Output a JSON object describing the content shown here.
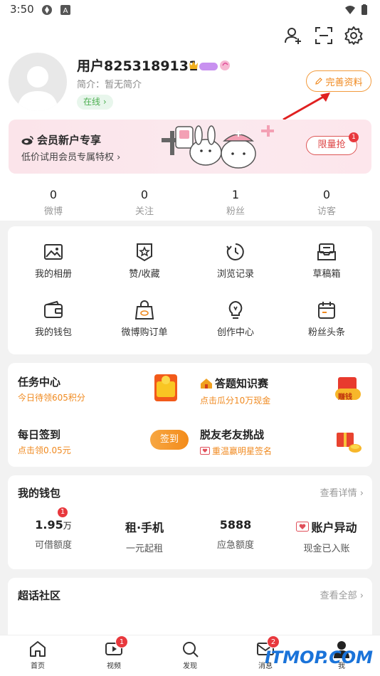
{
  "status_bar": {
    "time": "3:50"
  },
  "profile": {
    "username": "用户8253189131",
    "intro": "简介：暂无简介",
    "online": "在线 ›",
    "edit_button": "完善资料"
  },
  "banner": {
    "title": "会员新户专享",
    "subtitle": "低价试用会员专属特权 ›",
    "button": "限量抢",
    "badge": "1"
  },
  "stats": [
    {
      "value": "0",
      "label": "微博"
    },
    {
      "value": "0",
      "label": "关注"
    },
    {
      "value": "1",
      "label": "粉丝"
    },
    {
      "value": "0",
      "label": "访客"
    }
  ],
  "tools": [
    {
      "label": "我的相册",
      "icon": "photo-album-icon"
    },
    {
      "label": "赞/收藏",
      "icon": "like-collect-icon"
    },
    {
      "label": "浏览记录",
      "icon": "history-icon"
    },
    {
      "label": "草稿箱",
      "icon": "drafts-icon"
    },
    {
      "label": "我的钱包",
      "icon": "wallet-icon"
    },
    {
      "label": "微博购订单",
      "icon": "shopping-bag-icon"
    },
    {
      "label": "创作中心",
      "icon": "lightbulb-icon"
    },
    {
      "label": "粉丝头条",
      "icon": "fans-headline-icon"
    }
  ],
  "tasks": {
    "task_center": {
      "title": "任务中心",
      "sub": "今日待领605积分"
    },
    "quiz": {
      "title": "答题知识赛",
      "sub": "点击瓜分10万现金",
      "badge": "赚钱"
    },
    "checkin": {
      "title": "每日签到",
      "sub": "点击领0.05元",
      "button": "签到"
    },
    "friends": {
      "title": "脱友老友挑战",
      "sub": "重温赢明星签名"
    }
  },
  "wallet": {
    "title": "我的钱包",
    "more": "查看详情 ›",
    "items": [
      {
        "value": "1.95",
        "unit": "万",
        "label": "可借额度",
        "badge": "1"
      },
      {
        "value": "租·手机",
        "label": "一元起租"
      },
      {
        "value": "5888",
        "label": "应急额度"
      },
      {
        "value": "账户异动",
        "label": "现金已入账"
      }
    ]
  },
  "super_topics": {
    "title": "超话社区",
    "more": "查看全部 ›"
  },
  "bottom_nav": [
    {
      "label": "首页",
      "icon": "home-icon"
    },
    {
      "label": "视频",
      "icon": "video-icon",
      "badge": "1"
    },
    {
      "label": "发现",
      "icon": "discover-icon"
    },
    {
      "label": "消息",
      "icon": "message-icon",
      "badge": "2"
    },
    {
      "label": "我",
      "icon": "me-icon"
    }
  ],
  "watermark": "ITMOP.COM",
  "colors": {
    "accent": "#f08a20",
    "badge": "#e8383d",
    "online": "#4caf50",
    "banner": "#fbe4ea"
  }
}
